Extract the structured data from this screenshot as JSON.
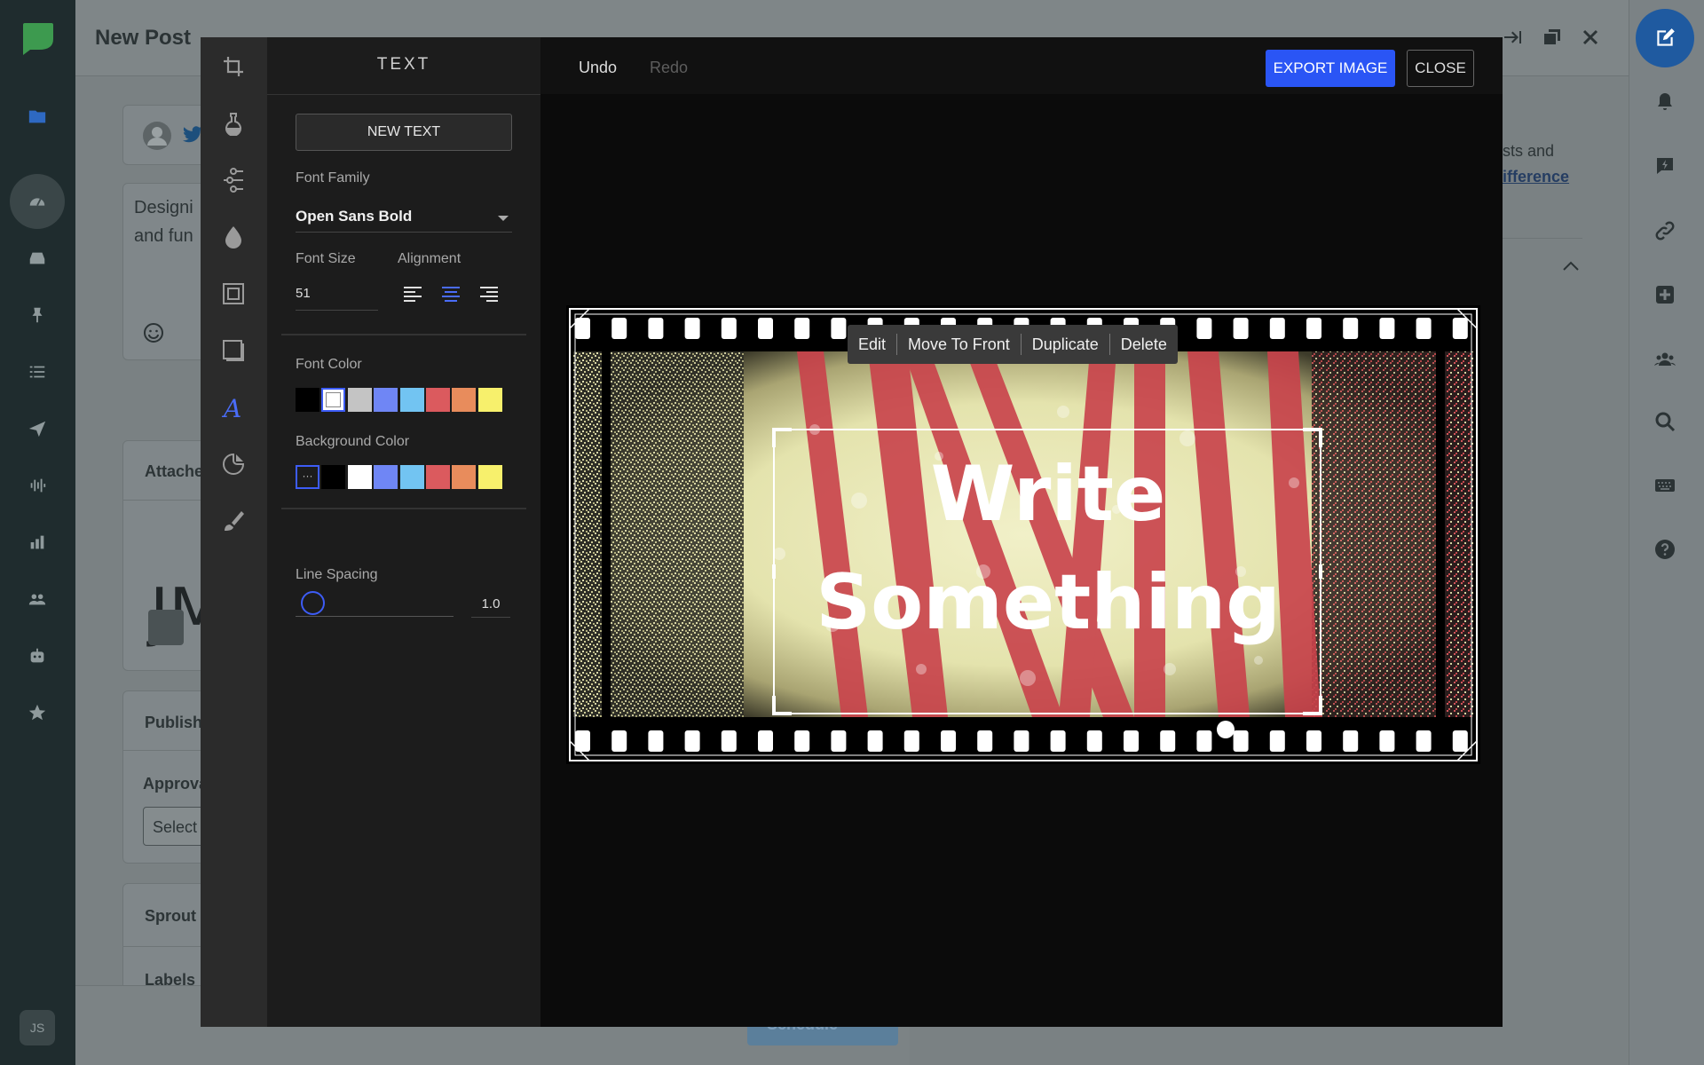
{
  "app": {
    "page_title": "New Post",
    "avatar_initials": "JS",
    "composer_text_line1": "Designi",
    "composer_text_line2": "and fun",
    "attached_label": "Attache",
    "publish_label": "Publish",
    "approval_label": "Approva",
    "select_label": "Select",
    "sprout_label": "Sprout",
    "labels_label": "Labels",
    "right_text": "sts and",
    "right_link": "ifference",
    "attach_preview_text": "JM",
    "schedule_label": "Schedule"
  },
  "editor": {
    "panel_title": "TEXT",
    "new_text_label": "NEW TEXT",
    "font_family_label": "Font Family",
    "font_family_value": "Open Sans Bold",
    "font_size_label": "Font Size",
    "font_size_value": "51",
    "alignment_label": "Alignment",
    "alignment_selected": "center",
    "font_color_label": "Font Color",
    "font_colors": [
      "#000000",
      "#ffffff",
      "#c4c4c4",
      "#6f86f5",
      "#72c4f2",
      "#db5a5e",
      "#e88c5c",
      "#f7f06c"
    ],
    "font_color_selected_index": 1,
    "background_color_label": "Background Color",
    "background_colors": [
      "transparent",
      "#000000",
      "#ffffff",
      "#6f86f5",
      "#72c4f2",
      "#db5a5e",
      "#e88c5c",
      "#f7f06c"
    ],
    "background_color_selected_index": 0,
    "line_spacing_label": "Line Spacing",
    "line_spacing_value": "1.0",
    "undo_label": "Undo",
    "redo_label": "Redo",
    "export_label": "EXPORT IMAGE",
    "close_label": "CLOSE",
    "context_menu": [
      "Edit",
      "Move To Front",
      "Duplicate",
      "Delete"
    ],
    "canvas_text_line1": "Write",
    "canvas_text_line2": "Something",
    "accent_color": "#2a55f5"
  },
  "tools": [
    "crop-icon",
    "filter-icon",
    "adjust-icon",
    "focus-icon",
    "frame-icon",
    "overlay-icon",
    "text-icon",
    "sticker-icon",
    "brush-icon"
  ]
}
